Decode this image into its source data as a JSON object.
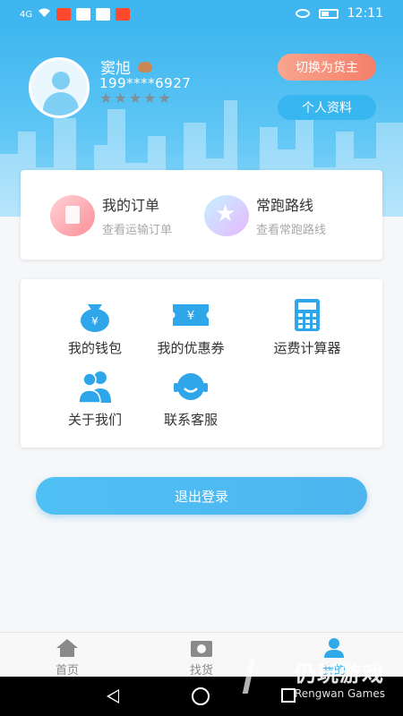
{
  "status_bar": {
    "signal": "4G",
    "time": "12:11",
    "icons": [
      "wifi-icon",
      "app-icon-1",
      "app-icon-2",
      "app-icon-3",
      "app-icon-4",
      "eye-icon",
      "battery-icon"
    ]
  },
  "profile": {
    "name": "窦旭",
    "phone": "199****6927",
    "rating_stars": 5,
    "switch_label": "切换为货主",
    "profile_label": "个人资料"
  },
  "quick_actions": [
    {
      "title": "我的订单",
      "subtitle": "查看运输订单",
      "icon": "order-icon"
    },
    {
      "title": "常跑路线",
      "subtitle": "查看常跑路线",
      "icon": "star-icon"
    }
  ],
  "grid_menu": [
    {
      "label": "我的钱包",
      "icon": "wallet-icon"
    },
    {
      "label": "我的优惠券",
      "icon": "coupon-icon"
    },
    {
      "label": "运费计算器",
      "icon": "calculator-icon"
    },
    {
      "label": "关于我们",
      "icon": "about-us-icon"
    },
    {
      "label": "联系客服",
      "icon": "customer-service-icon"
    }
  ],
  "logout_label": "退出登录",
  "tabs": [
    {
      "label": "首页",
      "icon": "home-icon"
    },
    {
      "label": "找货",
      "icon": "find-goods-icon"
    },
    {
      "label": "我的",
      "icon": "person-icon",
      "active": true
    }
  ],
  "watermark": {
    "main": "仍玩游戏",
    "sub": "Rengwan Games"
  },
  "colors": {
    "primary": "#3fb6ef",
    "accent": "#f47f69"
  }
}
